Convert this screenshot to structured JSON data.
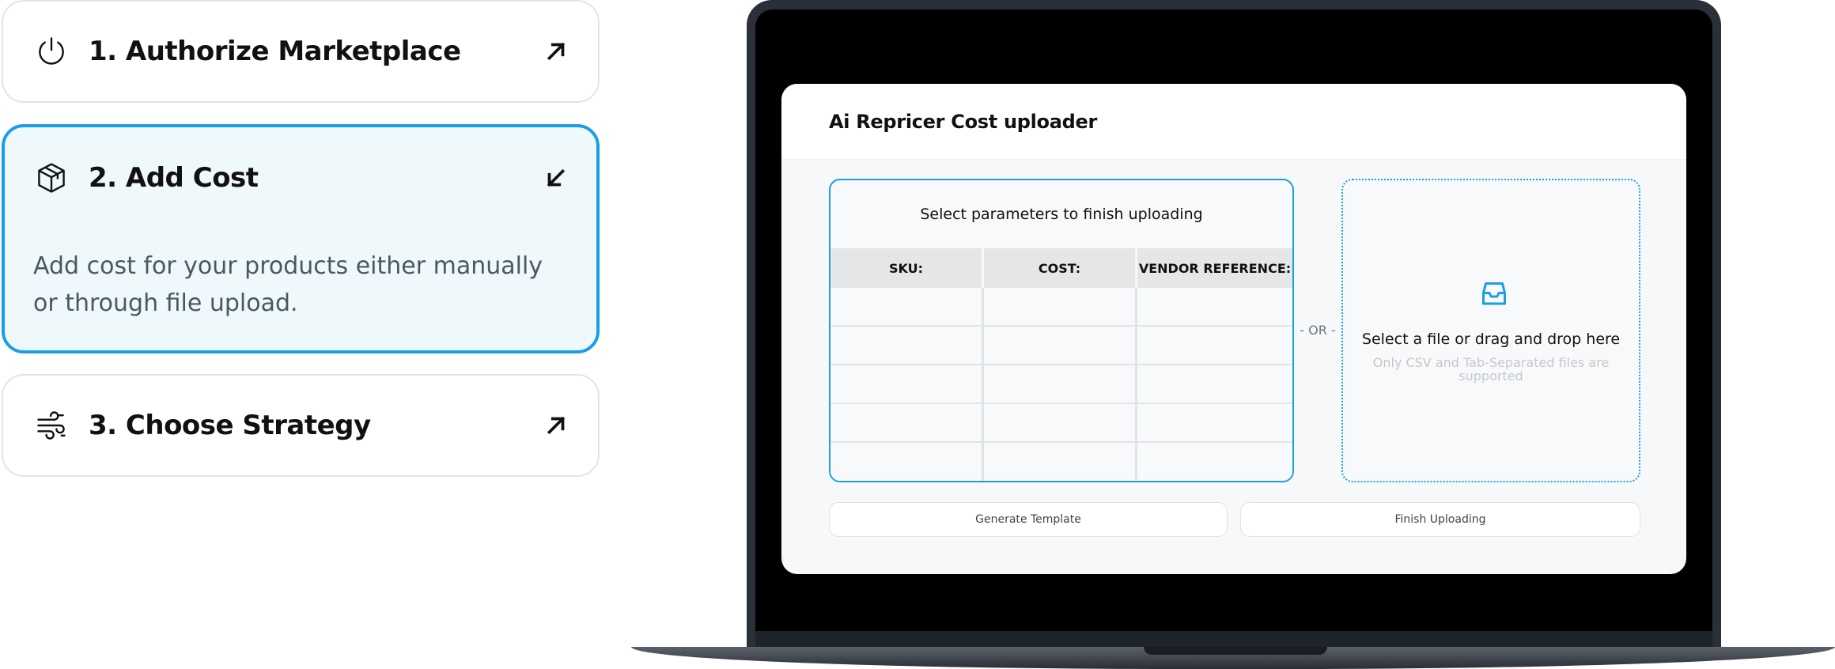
{
  "steps": [
    {
      "number_title": "1. Authorize Marketplace",
      "icon": "power-icon",
      "arrow": "arrow-up-right-icon",
      "active": false
    },
    {
      "number_title": "2. Add Cost",
      "icon": "box-icon",
      "arrow": "arrow-down-left-icon",
      "active": true,
      "description": "Add cost for your products either manually or through file upload."
    },
    {
      "number_title": "3. Choose Strategy",
      "icon": "wind-icon",
      "arrow": "arrow-up-right-icon",
      "active": false
    }
  ],
  "app": {
    "title": "Ai Repricer Cost uploader",
    "table": {
      "caption": "Select parameters to finish uploading",
      "columns": [
        "SKU:",
        "COST:",
        "VENDOR REFERENCE:"
      ],
      "rows": [
        [
          "",
          "",
          ""
        ],
        [
          "",
          "",
          ""
        ],
        [
          "",
          "",
          ""
        ],
        [
          "",
          "",
          ""
        ],
        [
          "",
          "",
          ""
        ]
      ]
    },
    "separator": "OR",
    "dropzone": {
      "title": "Select a file or drag and drop here",
      "hint": "Only CSV and Tab-Separated files are supported",
      "icon": "inbox-icon"
    },
    "buttons": {
      "generate_template": "Generate Template",
      "finish_uploading": "Finish Uploading"
    }
  },
  "colors": {
    "accent": "#1a9fe6",
    "active_card_bg": "#eff8fb",
    "laptop_frame": "#2b3038"
  }
}
